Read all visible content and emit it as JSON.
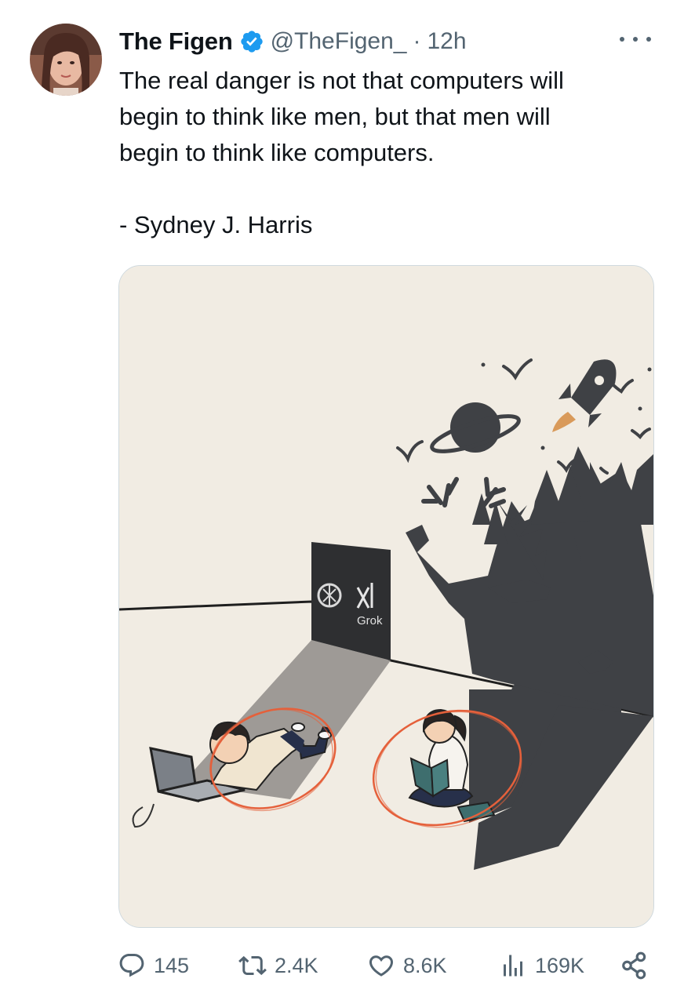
{
  "tweet": {
    "author_name": "The Figen",
    "handle": "@TheFigen_",
    "separator": "·",
    "time": "12h",
    "text": "The real danger is not that computers will\nbegin to think like men, but that men will\nbegin to think like computers.",
    "attribution": "- Sydney J. Harris",
    "verified": true
  },
  "media": {
    "door_label": "Grok"
  },
  "actions": {
    "replies": "145",
    "retweets": "2.4K",
    "likes": "8.6K",
    "views": "169K"
  },
  "colors": {
    "verified_blue": "#1d9bf0",
    "muted_text": "#536471",
    "text": "#0f1419",
    "image_background": "#f1ece3",
    "shadow": "#3f4145",
    "circle_annotation": "#e5603b"
  },
  "icons": {
    "more": "more-dots-icon",
    "reply": "reply-icon",
    "retweet": "retweet-icon",
    "like": "heart-icon",
    "views": "views-bar-chart-icon",
    "share": "share-icon",
    "verified": "verified-badge-icon"
  }
}
